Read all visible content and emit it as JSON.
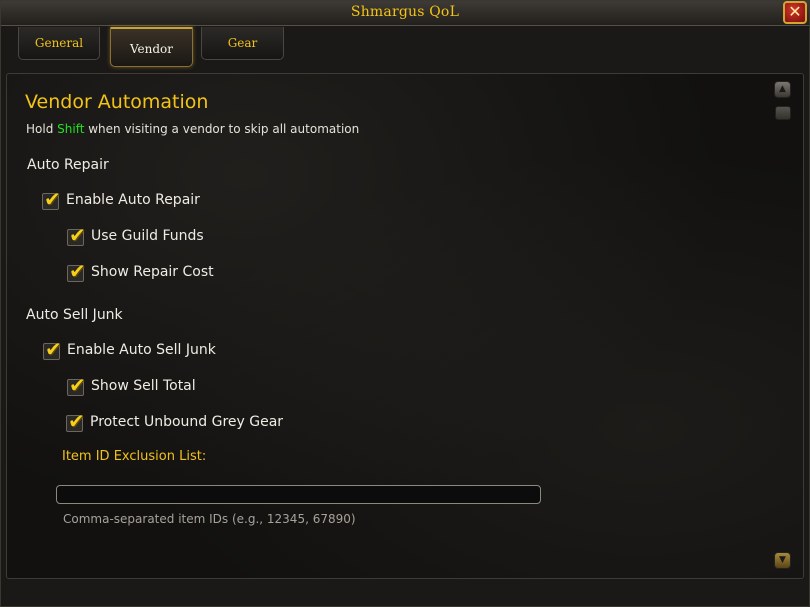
{
  "window": {
    "title": "Shmargus QoL",
    "close_glyph": "✕"
  },
  "tabs": [
    {
      "label": "General",
      "active": false
    },
    {
      "label": "Vendor",
      "active": true
    },
    {
      "label": "Gear",
      "active": false
    }
  ],
  "content": {
    "heading": "Vendor Automation",
    "hint_prefix": "Hold ",
    "hint_key": "Shift",
    "hint_suffix": " when visiting a vendor to skip all automation",
    "sections": {
      "auto_repair": {
        "title": "Auto Repair",
        "enable": {
          "label": "Enable Auto Repair",
          "checked": true
        },
        "guild_funds": {
          "label": "Use Guild Funds",
          "checked": true
        },
        "repair_cost": {
          "label": "Show Repair Cost",
          "checked": true
        }
      },
      "auto_sell": {
        "title": "Auto Sell Junk",
        "enable": {
          "label": "Enable Auto Sell Junk",
          "checked": true
        },
        "sell_total": {
          "label": "Show Sell Total",
          "checked": true
        },
        "protect_grey": {
          "label": "Protect Unbound Grey Gear",
          "checked": true
        }
      }
    },
    "exclusion": {
      "label": "Item ID Exclusion List:",
      "value": "",
      "help": "Comma-separated item IDs (e.g., 12345, 67890)"
    }
  },
  "icons": {
    "check": "✔",
    "scroll_up": "▲",
    "scroll_down": "▼"
  },
  "colors": {
    "accent_gold": "#f3c316",
    "key_green": "#22e022",
    "text": "#efece4"
  }
}
